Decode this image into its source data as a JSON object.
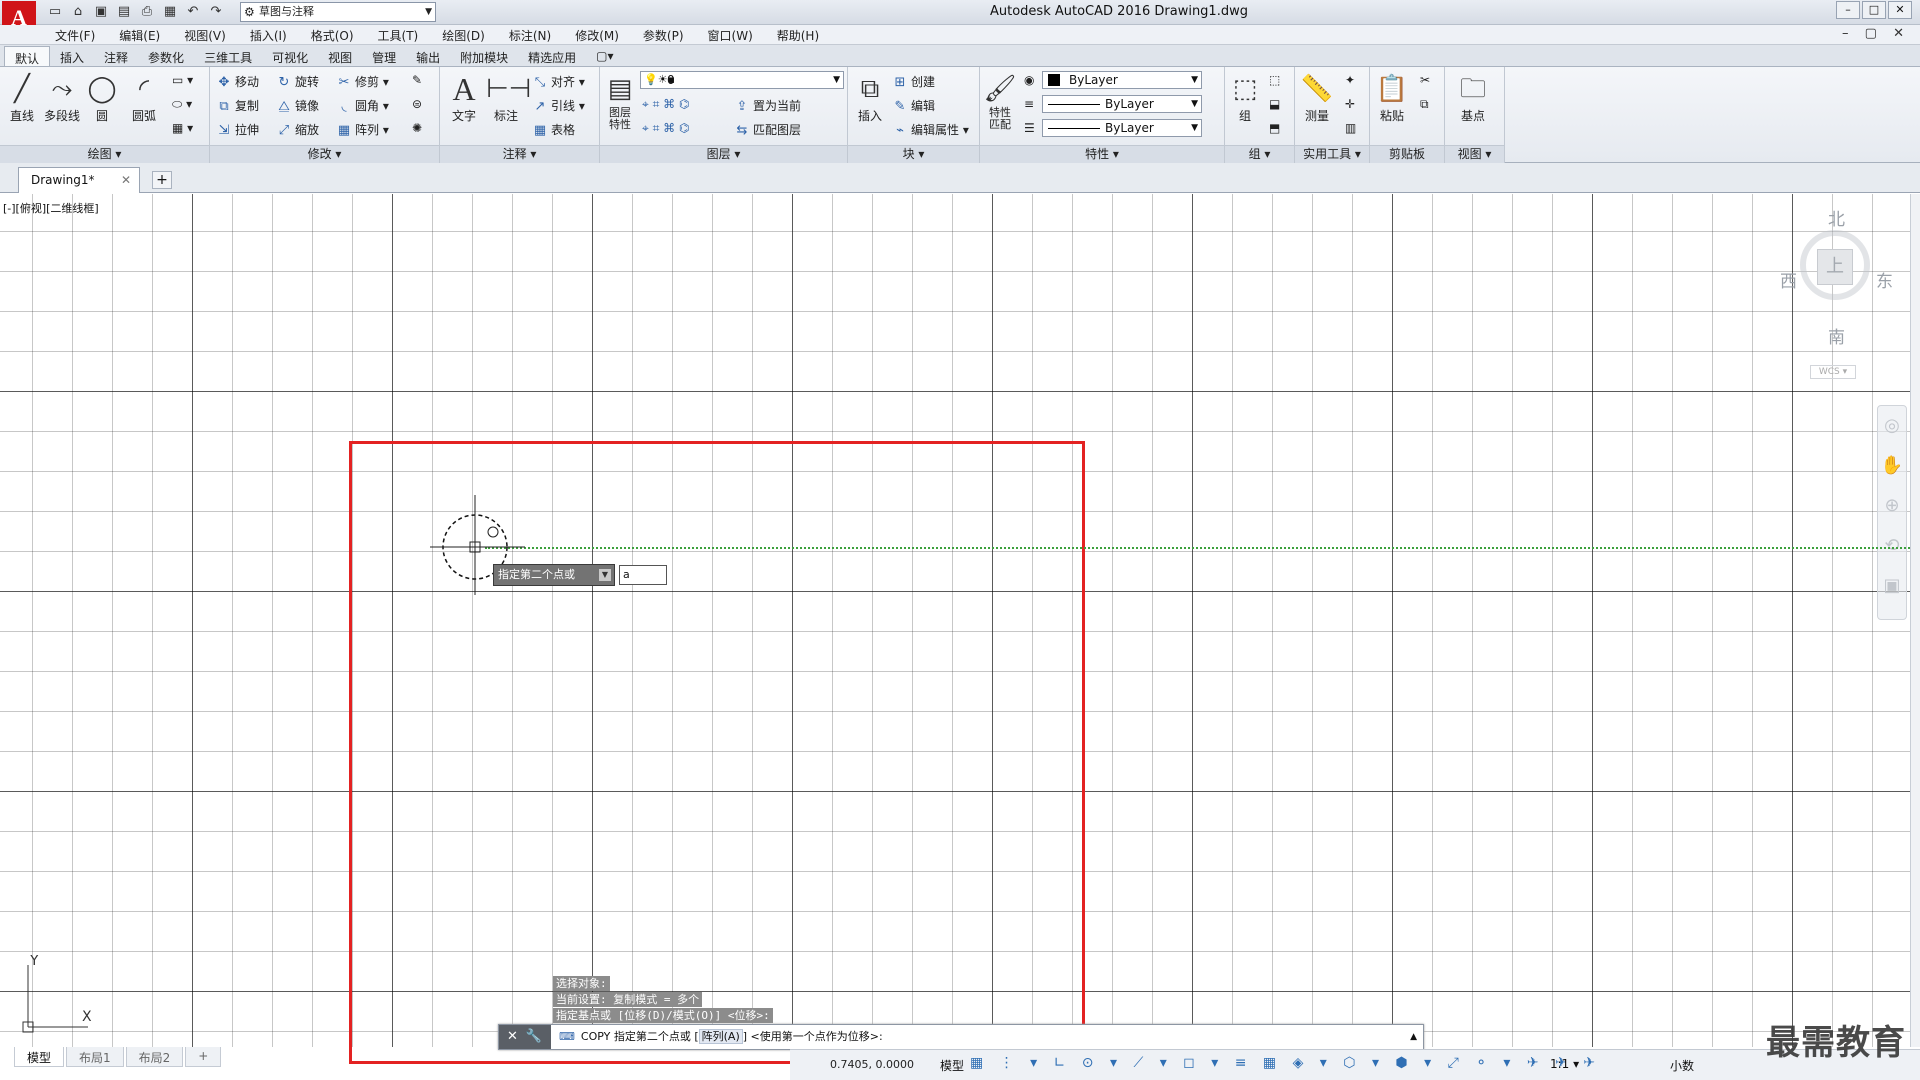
{
  "app": {
    "title": "Autodesk AutoCAD 2016    Drawing1.dwg",
    "logo_letter": "A",
    "workspace": "草图与注释",
    "window_controls": [
      "–",
      "□",
      "✕"
    ]
  },
  "menu": {
    "items": [
      "文件(F)",
      "编辑(E)",
      "视图(V)",
      "插入(I)",
      "格式(O)",
      "工具(T)",
      "绘图(D)",
      "标注(N)",
      "修改(M)",
      "参数(P)",
      "窗口(W)",
      "帮助(H)"
    ],
    "mdi_controls": "– ▢ ✕"
  },
  "ribbon_tabs": [
    "默认",
    "插入",
    "注释",
    "参数化",
    "三维工具",
    "可视化",
    "视图",
    "管理",
    "输出",
    "附加模块",
    "精选应用",
    "▢▾"
  ],
  "ribbon": {
    "draw": {
      "title": "绘图 ▾",
      "line": "直线",
      "polyline": "多段线",
      "circle": "圆",
      "arc": "圆弧"
    },
    "modify": {
      "title": "修改 ▾",
      "move": "移动",
      "rotate": "旋转",
      "trim": "修剪",
      "copy": "复制",
      "mirror": "镜像",
      "fillet": "圆角",
      "stretch": "拉伸",
      "scale": "缩放",
      "array": "阵列"
    },
    "annotation": {
      "title": "注释 ▾",
      "text": "文字",
      "dimension": "标注",
      "align": "对齐",
      "leader": "引线",
      "table": "表格"
    },
    "layers": {
      "title": "图层 ▾",
      "props": "图层\n特性",
      "current_layer": "0",
      "set_current": "置为当前",
      "match_layer": "匹配图层"
    },
    "block": {
      "title": "块 ▾",
      "insert": "插入",
      "create": "创建",
      "edit": "编辑",
      "edit_attr": "编辑属性"
    },
    "properties": {
      "title": "特性 ▾",
      "match": "特性\n匹配",
      "color": "ByLayer",
      "linetype": "ByLayer",
      "lineweight": "ByLayer"
    },
    "group": {
      "title": "组 ▾",
      "group": "组"
    },
    "utilities": {
      "title": "实用工具 ▾",
      "measure": "测量"
    },
    "clipboard": {
      "title": "剪贴板",
      "paste": "粘贴"
    },
    "view": {
      "title": "视图 ▾",
      "base": "基点"
    }
  },
  "doc_tab": {
    "name": "Drawing1*",
    "close": "✕",
    "new": "+"
  },
  "viewport_label": "[-][俯视][二维线框]",
  "viewcube": {
    "north": "北",
    "south": "南",
    "west": "西",
    "east": "东",
    "top": "上",
    "wcs": "WCS ▾"
  },
  "ucs": {
    "y": "Y",
    "x": "X"
  },
  "tooltip": {
    "prompt": "指定第二个点或",
    "input_value": "a"
  },
  "command_history": [
    "选择对象:",
    "当前设置:  复制模式 = 多个",
    "指定基点或 [位移(D)/模式(O)] <位移>:"
  ],
  "command_line": {
    "cmd": "COPY 指定第二个点或 [",
    "keyword": "阵列(A)",
    "rest": "] <使用第一个点作为位移>:"
  },
  "layout_tabs": [
    "模型",
    "布局1",
    "布局2",
    "+"
  ],
  "status": {
    "coords": "0.7405, 0.0000",
    "model": "模型",
    "scale": "1:1 ▾",
    "units": "小数"
  },
  "watermark": "最需教育",
  "colors": {
    "selection_rect": "#e32222",
    "guide": "#3ca03c",
    "logo": "#d01418"
  }
}
